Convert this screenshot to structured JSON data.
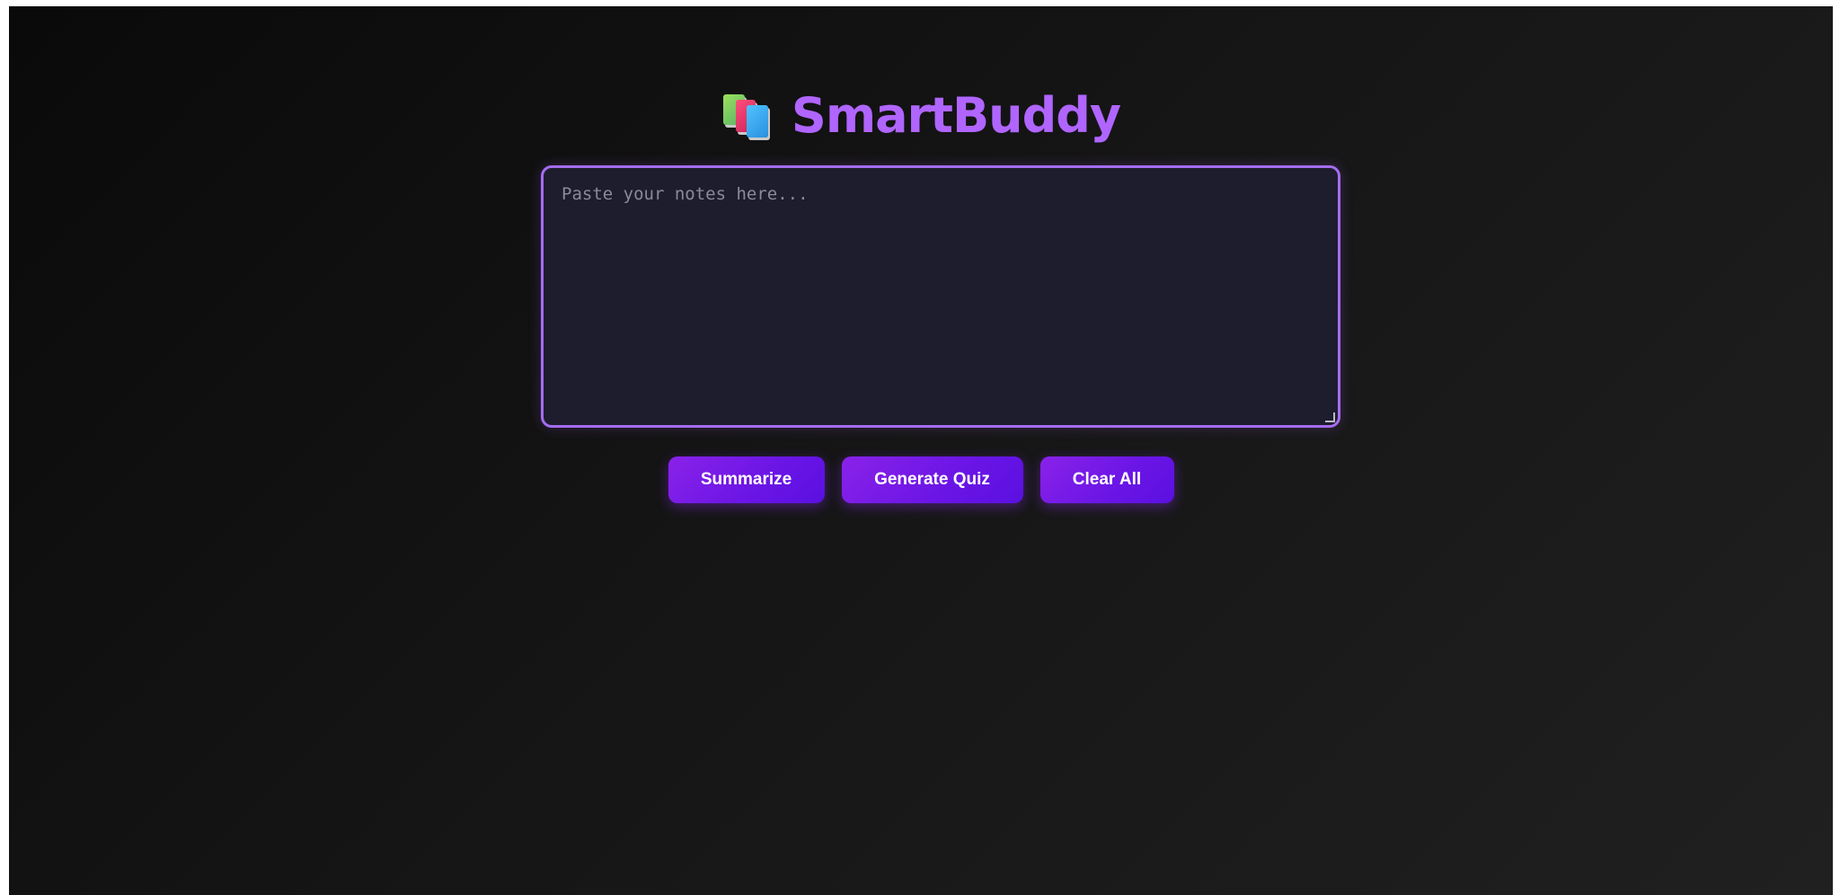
{
  "app": {
    "title": "SmartBuddy",
    "logo_icon": "books-icon"
  },
  "notes": {
    "placeholder": "Paste your notes here...",
    "value": ""
  },
  "actions": {
    "summarize_label": "Summarize",
    "generate_quiz_label": "Generate Quiz",
    "clear_all_label": "Clear All"
  },
  "colors": {
    "accent": "#b065ff",
    "button": "#7a1be8",
    "textarea_bg": "#1e1d2e",
    "textarea_border": "#a56cf0"
  }
}
